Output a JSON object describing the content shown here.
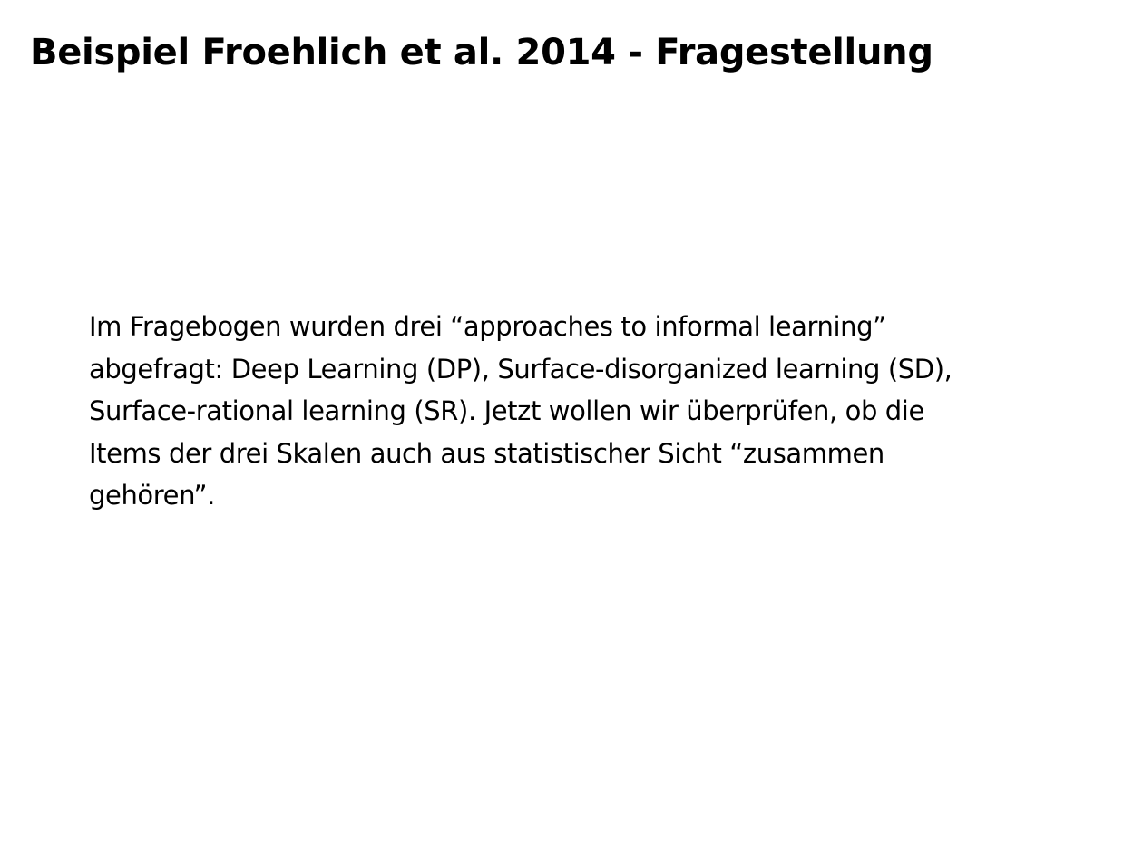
{
  "slide": {
    "title": "Beispiel Froehlich et al. 2014 - Fragestellung",
    "body_lines": [
      "Im Fragebogen wurden drei “approaches to informal learning”",
      "abgefragt: Deep Learning (DP), Surface-disorganized learning (SD),",
      "Surface-rational learning (SR). Jetzt wollen wir überprüfen, ob die",
      "Items der drei Skalen auch aus statistischer Sicht “zusammen",
      "gehören”."
    ]
  }
}
